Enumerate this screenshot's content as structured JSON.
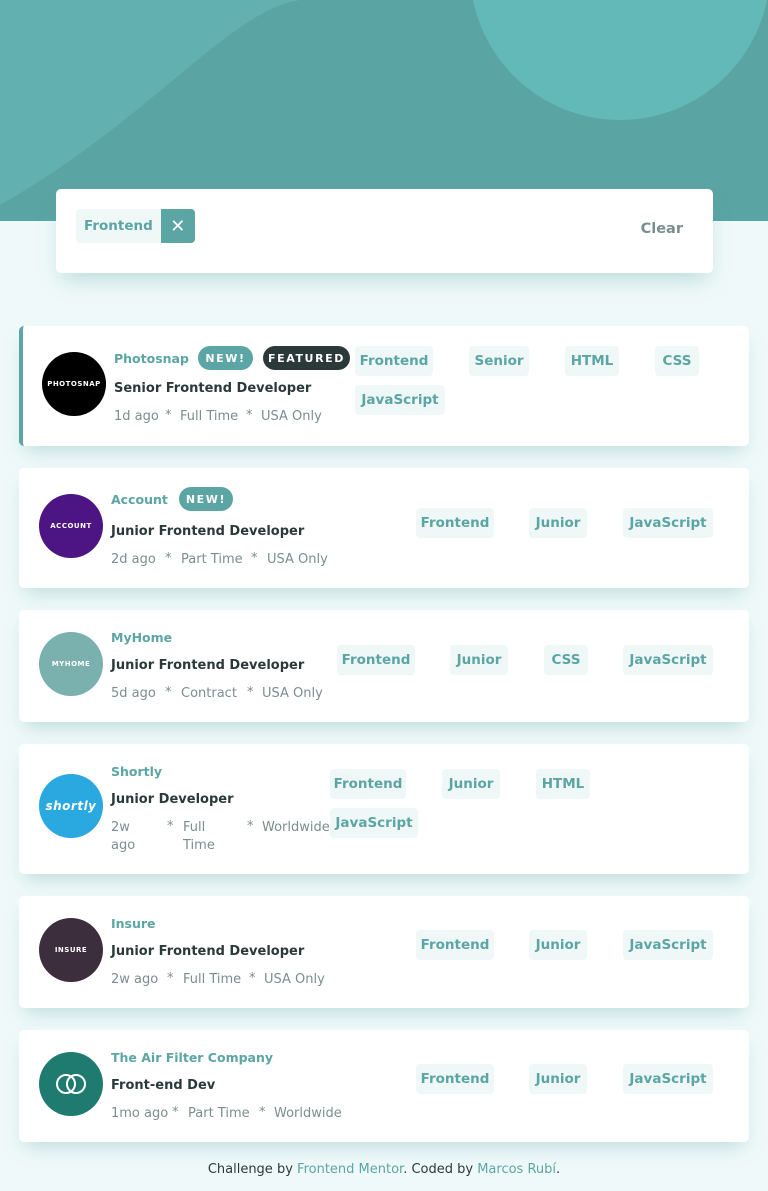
{
  "filter": {
    "chips": [
      {
        "label": "Frontend"
      }
    ],
    "clear_label": "Clear"
  },
  "jobs": [
    {
      "company": "Photosnap",
      "logo_text": "PHOTOSNAP",
      "badges": [
        "NEW!",
        "FEATURED"
      ],
      "position": "Senior Frontend Developer",
      "posted": "1d ago",
      "contract": "Full Time",
      "location": "USA Only",
      "tags": [
        "Frontend",
        "Senior",
        "HTML",
        "CSS",
        "JavaScript"
      ]
    },
    {
      "company": "Account",
      "logo_text": "ACCOUNT",
      "badges": [
        "NEW!"
      ],
      "position": "Junior Frontend Developer",
      "posted": "2d ago",
      "contract": "Part Time",
      "location": "USA Only",
      "tags": [
        "Frontend",
        "Junior",
        "JavaScript"
      ]
    },
    {
      "company": "MyHome",
      "logo_text": "MYHOME",
      "badges": [],
      "position": "Junior Frontend Developer",
      "posted": "5d ago",
      "contract": "Contract",
      "location": "USA Only",
      "tags": [
        "Frontend",
        "Junior",
        "CSS",
        "JavaScript"
      ]
    },
    {
      "company": "Shortly",
      "logo_text": "shortly",
      "badges": [],
      "position": "Junior Developer",
      "posted": "2w ago",
      "contract": "Full Time",
      "location": "Worldwide",
      "tags": [
        "Frontend",
        "Junior",
        "HTML",
        "JavaScript"
      ]
    },
    {
      "company": "Insure",
      "logo_text": "INSURE",
      "badges": [],
      "position": "Junior Frontend Developer",
      "posted": "2w ago",
      "contract": "Full Time",
      "location": "USA Only",
      "tags": [
        "Frontend",
        "Junior",
        "JavaScript"
      ]
    },
    {
      "company": "The Air Filter Company",
      "logo_text": "",
      "badges": [],
      "position": "Front-end Dev",
      "posted": "1mo ago",
      "contract": "Part Time",
      "location": "Worldwide",
      "tags": [
        "Frontend",
        "Junior",
        "JavaScript"
      ]
    }
  ],
  "footer": {
    "prefix": "Challenge by",
    "mentor": "Frontend Mentor",
    "middle": ". Coded by",
    "author": "Marcos Rubí",
    "suffix": "."
  },
  "colors": {
    "primary": "#5ca5a5",
    "background": "#eff9f9",
    "dark": "#2b3939",
    "gray": "#7b8e8e"
  }
}
